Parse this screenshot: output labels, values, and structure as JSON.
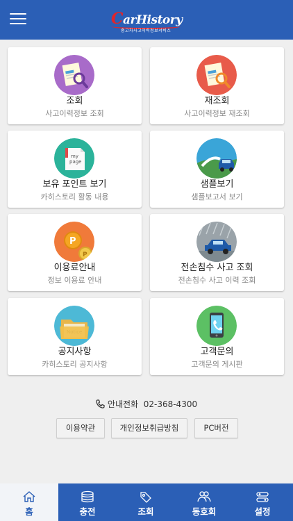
{
  "header": {
    "logo_text": "CarHistory",
    "logo_sub": "중고차사고이력정보서비스",
    "menu_icon": "hamburger-menu-icon"
  },
  "cards": [
    {
      "title": "조회",
      "subtitle": "사고이력정보 조회",
      "icon": "search-report-icon",
      "color": "#a86bc9"
    },
    {
      "title": "재조회",
      "subtitle": "사고이력정보 재조회",
      "icon": "re-search-report-icon",
      "color": "#e85b4a"
    },
    {
      "title": "보유 포인트 보기",
      "subtitle": "카히스토리 활동 내용",
      "icon": "my-page-icon",
      "color": "#2bb39a"
    },
    {
      "title": "샘플보기",
      "subtitle": "샘플보고서 보기",
      "icon": "sample-car-icon",
      "color": "#3aa5d8"
    },
    {
      "title": "이용료안내",
      "subtitle": "정보 이용료 안내",
      "icon": "point-coin-icon",
      "color": "#f07a3a"
    },
    {
      "title": "전손침수 사고 조회",
      "subtitle": "전손침수 사고 이력 조회",
      "icon": "flood-car-icon",
      "color": "#9aa3a9"
    },
    {
      "title": "공지사항",
      "subtitle": "카히스토리 공지사항",
      "icon": "notice-folder-icon",
      "color": "#4db9d6"
    },
    {
      "title": "고객문의",
      "subtitle": "고객문의 게시판",
      "icon": "phone-icon",
      "color": "#5cc064"
    }
  ],
  "contact": {
    "label": "안내전화",
    "number": "02-368-4300"
  },
  "links": {
    "terms": "이용약관",
    "privacy": "개인정보취급방침",
    "pc": "PC버전"
  },
  "tabs": [
    {
      "label": "홈",
      "icon": "home-icon",
      "active": true
    },
    {
      "label": "충전",
      "icon": "coins-icon",
      "active": false
    },
    {
      "label": "조회",
      "icon": "search-tag-icon",
      "active": false
    },
    {
      "label": "동호회",
      "icon": "community-icon",
      "active": false
    },
    {
      "label": "설정",
      "icon": "settings-icon",
      "active": false
    }
  ],
  "colors": {
    "primary": "#2b5fb6",
    "background": "#efefef",
    "logo_accent": "#e0252b"
  }
}
